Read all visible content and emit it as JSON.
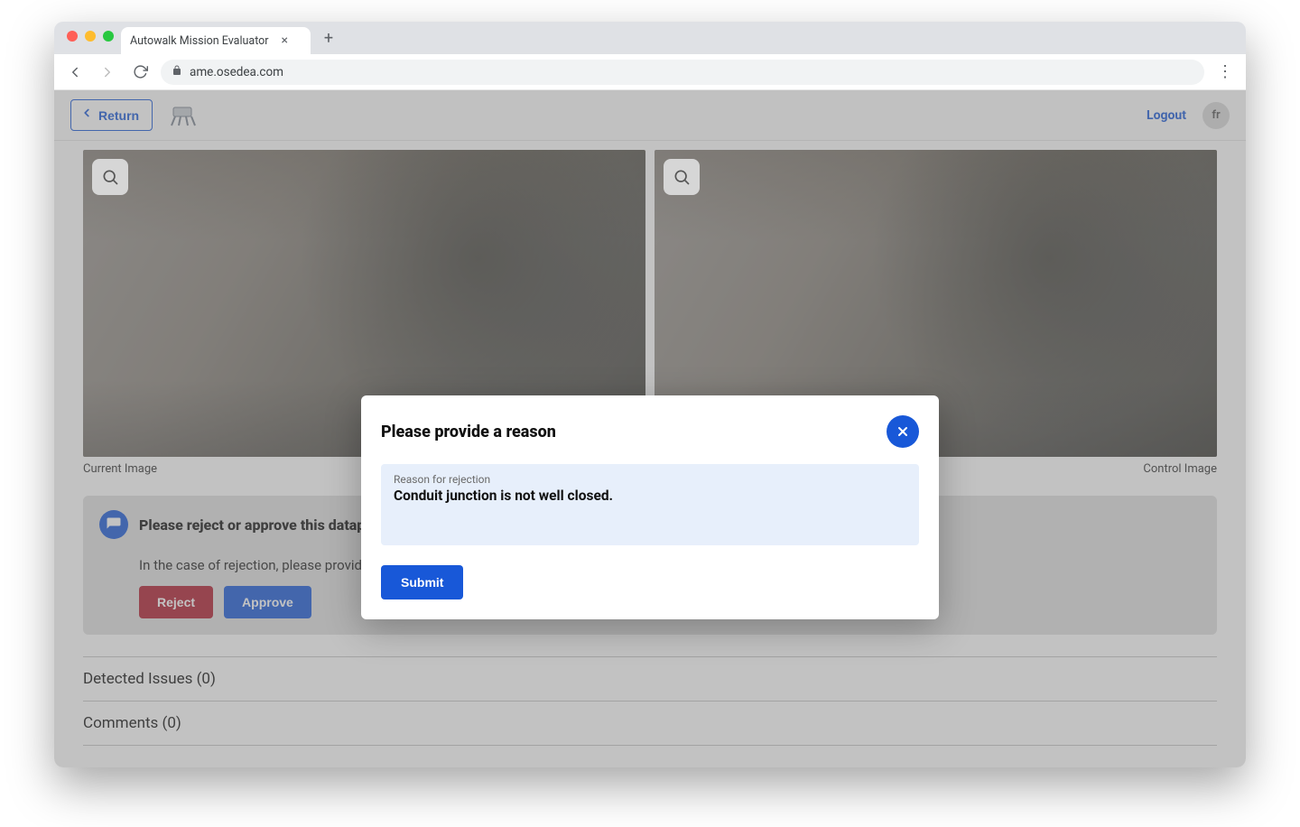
{
  "browser": {
    "tab_title": "Autowalk Mission Evaluator",
    "url": "ame.osedea.com"
  },
  "header": {
    "return_label": "Return",
    "logout_label": "Logout",
    "lang_badge": "fr"
  },
  "images": {
    "left_caption": "Current Image",
    "right_caption": "Control Image"
  },
  "review": {
    "title": "Please reject or approve this datapoint:",
    "subtitle": "In the case of rejection, please provide a reason",
    "reject_label": "Reject",
    "approve_label": "Approve"
  },
  "sections": {
    "detected_issues_label": "Detected Issues (0)",
    "comments_label": "Comments (0)"
  },
  "modal": {
    "title": "Please provide a reason",
    "textarea_label": "Reason for rejection",
    "textarea_value": "Conduit junction is not well closed.",
    "submit_label": "Submit"
  }
}
